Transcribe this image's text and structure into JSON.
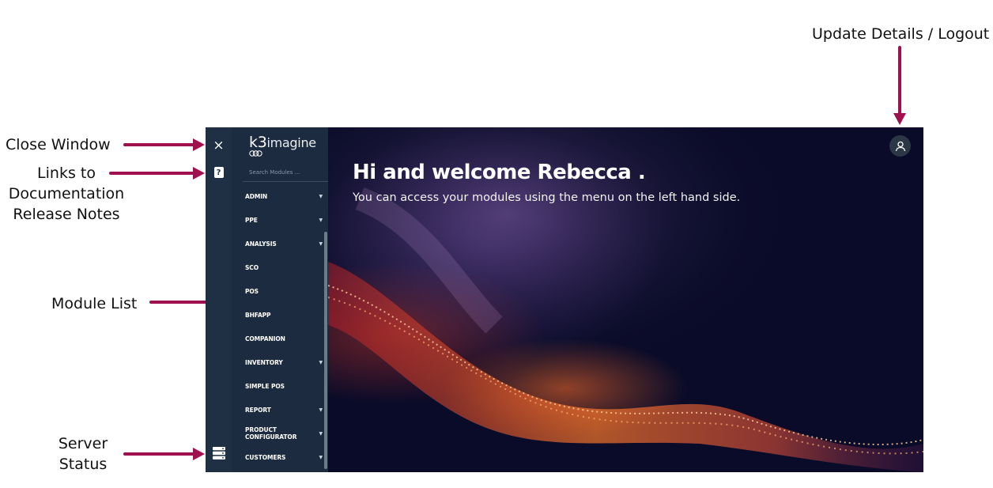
{
  "annotations": {
    "update_details": "Update Details / Logout",
    "close_window": "Close Window",
    "links_line1": "Links to",
    "links_line2": "Documentation",
    "links_line3": "Release Notes",
    "module_list": "Module List",
    "server_line1": "Server",
    "server_line2": "Status",
    "arrow_color": "#a0104f"
  },
  "app": {
    "close_label": "×",
    "help_label": "?",
    "logo_k3": "k3",
    "logo_text": "imagine",
    "search_placeholder": "Search Modules ...",
    "modules": [
      {
        "label": "ADMIN",
        "caret": "▼"
      },
      {
        "label": "PPE",
        "caret": "▼"
      },
      {
        "label": "ANALYSIS",
        "caret": "▼"
      },
      {
        "label": "SCO",
        "caret": ""
      },
      {
        "label": "POS",
        "caret": ""
      },
      {
        "label": "BHFAPP",
        "caret": ""
      },
      {
        "label": "COMPANION",
        "caret": ""
      },
      {
        "label": "INVENTORY",
        "caret": "▼"
      },
      {
        "label": "SIMPLE POS",
        "caret": ""
      },
      {
        "label": "REPORT",
        "caret": "▼"
      },
      {
        "label": "PRODUCT CONFIGURATOR",
        "caret": "▼"
      },
      {
        "label": "CUSTOMERS",
        "caret": "▼"
      }
    ],
    "welcome_title": "Hi and welcome Rebecca .",
    "welcome_subtitle": "You can access your modules using the menu on the left hand side.",
    "colors": {
      "rail": "#1f2f44",
      "menu": "#1d2b40",
      "hero": "#0a0b28"
    }
  }
}
